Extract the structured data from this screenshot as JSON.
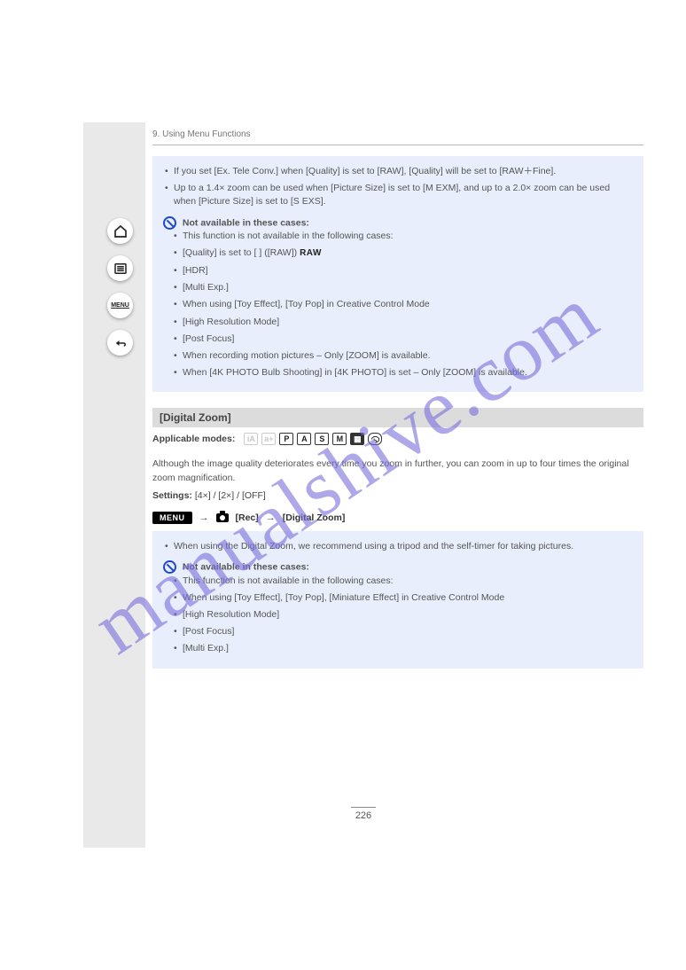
{
  "watermark": "manualshive.com",
  "header": "9. Using Menu Functions",
  "box1": {
    "b1": "If you set [Ex. Tele Conv.] when [Quality] is set to [RAW], [Quality] will be set to [RAW＋Fine].",
    "b2": "Up to a 1.4× zoom can be used when [Picture Size] is set to [M EXM], and up to a 2.0× zoom can be used when [Picture Size] is set to [S EXS].",
    "no_label": "Not available in these cases:",
    "n1": "This function is not available in the following cases:",
    "n2": "[Quality] is set to [   ] ([RAW])",
    "n3": "[HDR]",
    "n4": "[Multi Exp.]",
    "n5": "When using [Toy Effect], [Toy Pop] in Creative Control Mode",
    "n6": "[High Resolution Mode]",
    "n7": "[Post Focus]",
    "n8": "When recording motion pictures – Only [ZOOM] is available.",
    "n9": "When [4K PHOTO Bulb Shooting] in [4K PHOTO] is set – Only [ZOOM] is available."
  },
  "section": {
    "title": "[Digital Zoom]",
    "modes_label": "Applicable modes:",
    "desc": "Although the image quality deteriorates every time you zoom in further, you can zoom in up to four times the original zoom magnification.",
    "settings_label": "Settings:",
    "settings_value": "[4×] / [2×] / [OFF]"
  },
  "menu_path": {
    "menu": "MENU",
    "rec": "[Rec]",
    "item": "[Digital Zoom]"
  },
  "box2": {
    "b1": "When using the Digital Zoom, we recommend using a tripod and the self-timer for taking pictures.",
    "no_label": "Not available in these cases:",
    "n1": "This function is not available in the following cases:",
    "n2": "When using [Toy Effect], [Toy Pop], [Miniature Effect] in Creative Control Mode",
    "n3": "[High Resolution Mode]",
    "n4": "[Post Focus]",
    "n5": "[Multi Exp.]"
  },
  "page_number": "226"
}
